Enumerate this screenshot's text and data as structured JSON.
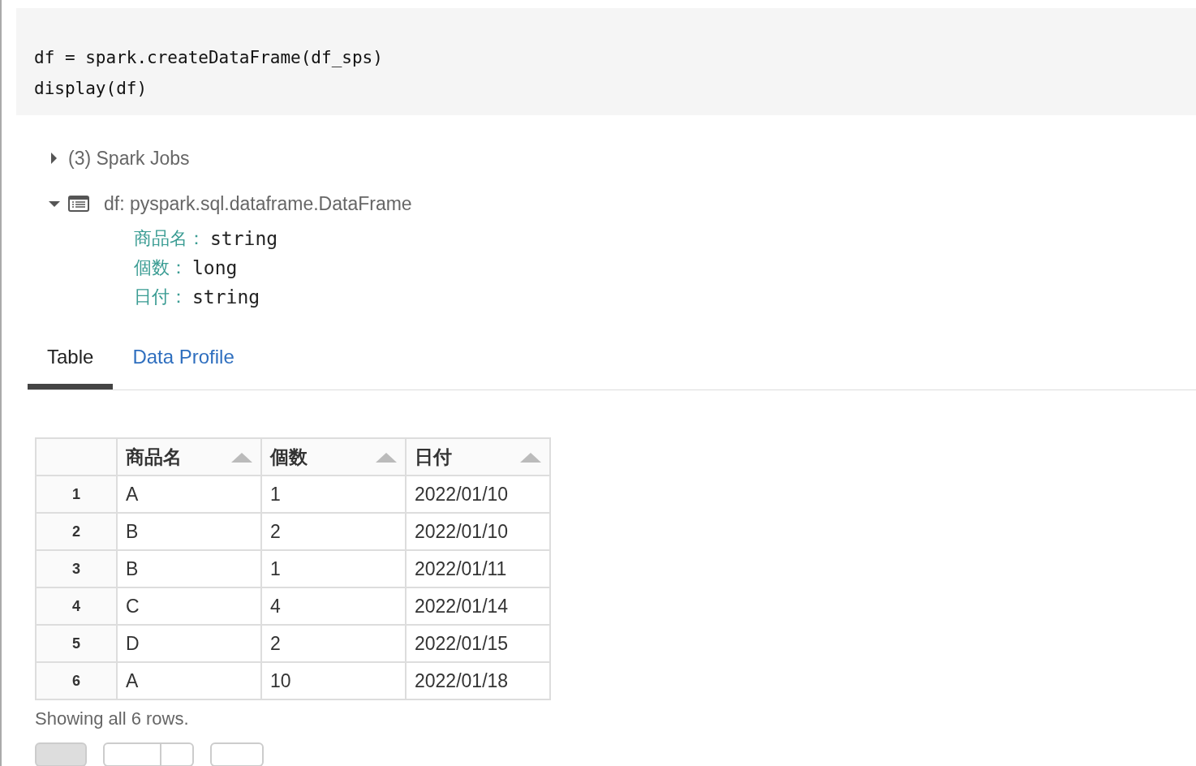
{
  "code": {
    "lines": [
      "df = spark.createDataFrame(df_sps)",
      "display(df)"
    ]
  },
  "outputs": [
    {
      "kind": "jobs",
      "label": "(3) Spark Jobs",
      "expanded": false
    },
    {
      "kind": "schema",
      "label": "df:  pyspark.sql.dataframe.DataFrame",
      "expanded": true,
      "fields": [
        {
          "name": "商品名：",
          "type": "string"
        },
        {
          "name": "個数：",
          "type": "long"
        },
        {
          "name": "日付：",
          "type": "string"
        }
      ]
    }
  ],
  "tabs": [
    {
      "label": "Table",
      "selected": true
    },
    {
      "label": "Data Profile",
      "selected": false
    }
  ],
  "table": {
    "columns": [
      "商品名",
      "個数",
      "日付"
    ],
    "rows": [
      {
        "index": "1",
        "cells": [
          "A",
          "1",
          "2022/01/10"
        ]
      },
      {
        "index": "2",
        "cells": [
          "B",
          "2",
          "2022/01/10"
        ]
      },
      {
        "index": "3",
        "cells": [
          "B",
          "1",
          "2022/01/11"
        ]
      },
      {
        "index": "4",
        "cells": [
          "C",
          "4",
          "2022/01/14"
        ]
      },
      {
        "index": "5",
        "cells": [
          "D",
          "2",
          "2022/01/15"
        ]
      },
      {
        "index": "6",
        "cells": [
          "A",
          "10",
          "2022/01/18"
        ]
      }
    ]
  },
  "status": "Showing all 6 rows."
}
